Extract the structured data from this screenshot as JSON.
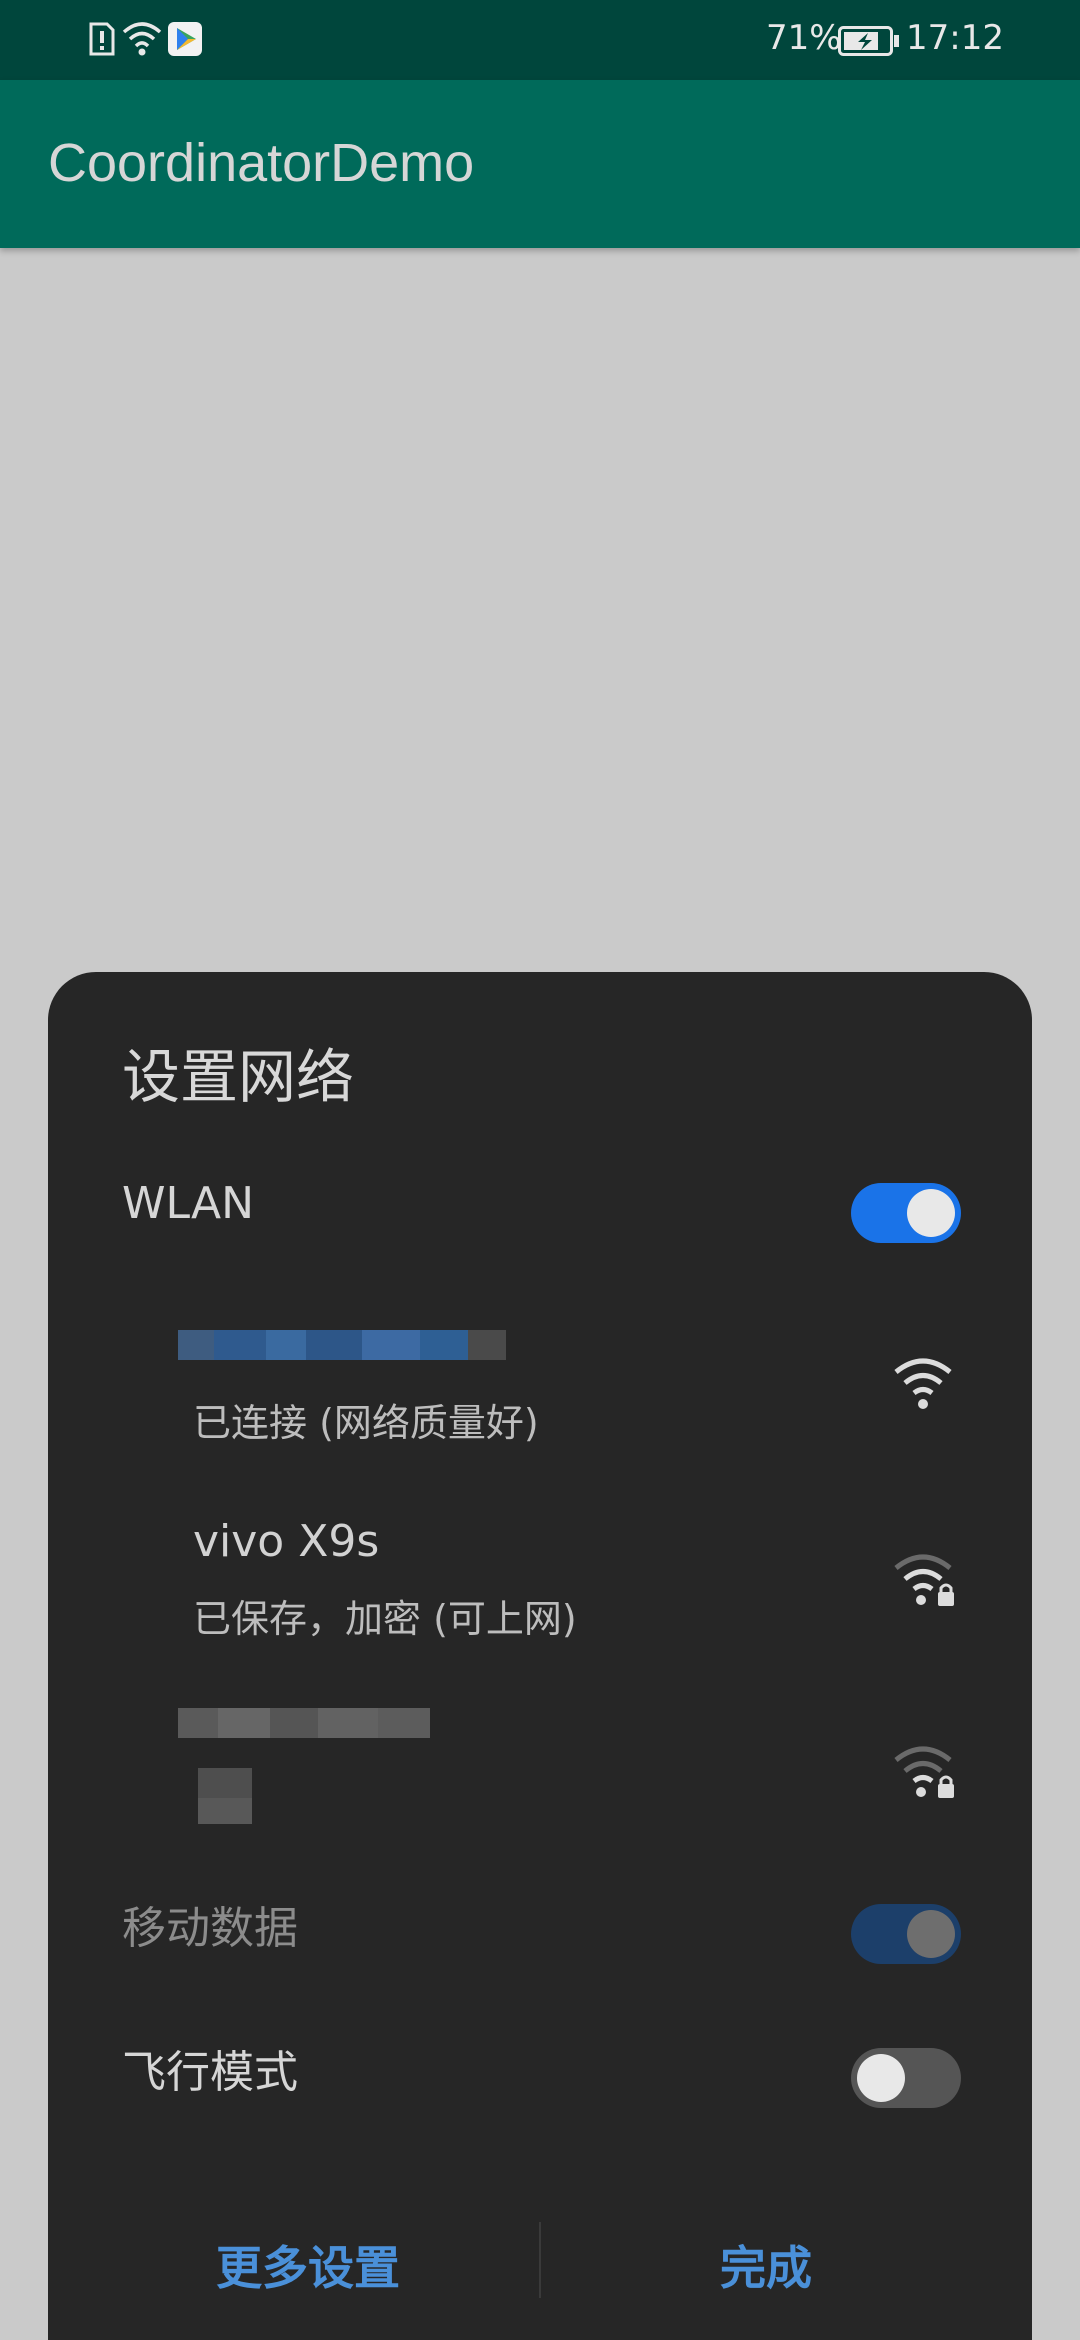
{
  "status_bar": {
    "battery": "71%",
    "time": "17:12",
    "icons": [
      "alert-sim-icon",
      "wifi-icon",
      "play-app-icon",
      "battery-charging-icon"
    ]
  },
  "app_bar": {
    "title": "CoordinatorDemo"
  },
  "dialog": {
    "title": "设置网络",
    "wlan": {
      "label": "WLAN",
      "on": true
    },
    "networks": [
      {
        "name": "",
        "status": "已连接 (网络质量好)",
        "icon": "wifi-full-icon",
        "locked": false,
        "name_obscured": true
      },
      {
        "name": "vivo X9s",
        "status": "已保存，加密 (可上网)",
        "icon": "wifi-lock-icon",
        "locked": true,
        "name_obscured": false
      },
      {
        "name": "",
        "status": "",
        "icon": "wifi-lock-icon",
        "locked": true,
        "name_obscured": true
      }
    ],
    "mobile_data": {
      "label": "移动数据",
      "on": true,
      "disabled": true
    },
    "airplane": {
      "label": "飞行模式",
      "on": false
    },
    "more_button": "更多设置",
    "done_button": "完成"
  },
  "colors": {
    "statusbar": "#00463c",
    "appbar": "#006a5a",
    "dialog": "#262626",
    "accent": "#1a73e8",
    "button_text": "#4a90d9"
  }
}
